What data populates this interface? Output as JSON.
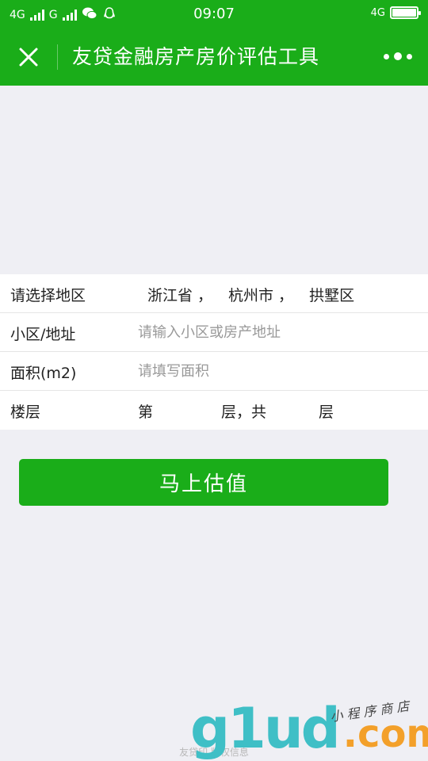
{
  "status_bar": {
    "network_left": "4G",
    "network_left2": "G",
    "time": "09:07",
    "network_right": "4G"
  },
  "nav": {
    "title": "友贷金融房产房价评估工具"
  },
  "form": {
    "region": {
      "label": "请选择地区",
      "province": "浙江省",
      "city": "杭州市",
      "district": "拱墅区",
      "separator": "，"
    },
    "address": {
      "label": "小区/地址",
      "placeholder": "请输入小区或房产地址",
      "value": ""
    },
    "area": {
      "label": "面积(m2)",
      "placeholder": "请填写面积",
      "value": ""
    },
    "floor": {
      "label": "楼层",
      "prefix": "第",
      "middle": "层，共",
      "suffix": "层",
      "value_floor": "",
      "value_total": ""
    }
  },
  "submit_label": "马上估值",
  "footer": "友贷印 版权信息",
  "watermark": {
    "main": "g1ud",
    "dot": ".com",
    "sub": "小 程 序 商 店"
  },
  "colors": {
    "brand_green": "#1aad19",
    "background": "#efeff4"
  }
}
